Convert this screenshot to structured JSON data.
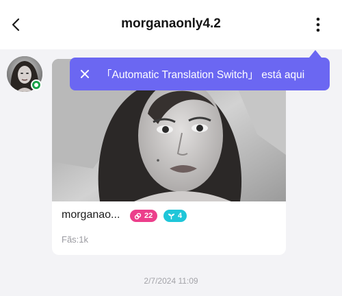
{
  "header": {
    "title": "morganaonly4.2",
    "back_icon": "chevron-left-icon",
    "more_icon": "more-vertical-icon"
  },
  "tooltip": {
    "text": "「Automatic Translation Switch」 está aqui",
    "close_icon": "close-icon",
    "color": "#6b67f2"
  },
  "card": {
    "name": "morganao...",
    "badges": [
      {
        "icon": "link-icon",
        "count": "22",
        "color": "#ec3f8b"
      },
      {
        "icon": "sprout-icon",
        "count": "4",
        "color": "#1fc6d9"
      }
    ],
    "fans": "Fãs:1k"
  },
  "status": {
    "online_color": "#1aa34a"
  },
  "message_time": "2/7/2024 11:09"
}
